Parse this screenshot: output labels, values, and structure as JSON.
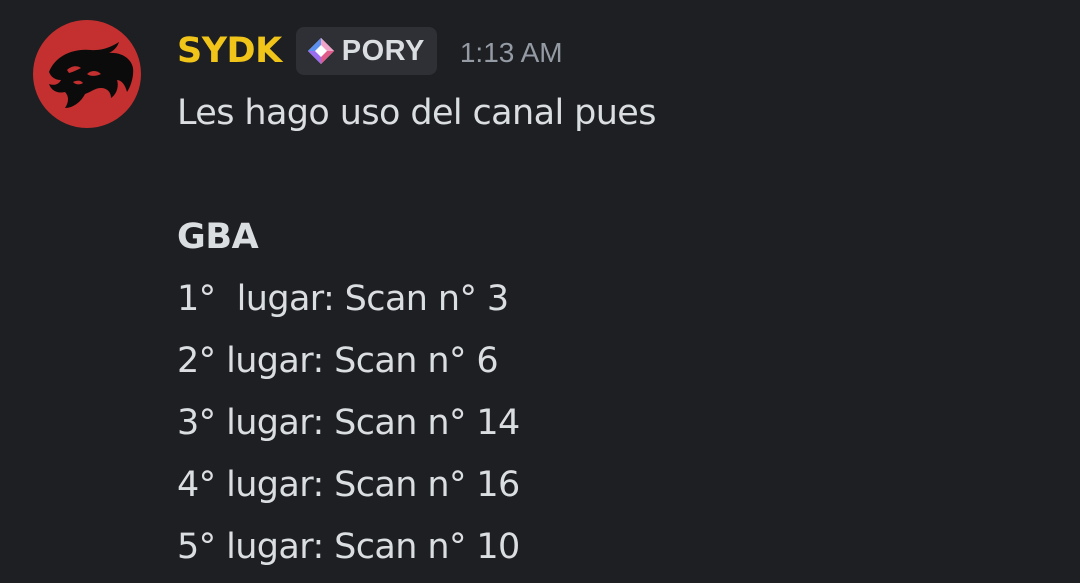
{
  "message": {
    "author": "SYDK",
    "author_color": "#f0c419",
    "tag": {
      "icon": "diamond-gem-icon",
      "label": "PORY"
    },
    "timestamp": "1:13 AM",
    "avatar": {
      "icon": "thundercats-emblem-icon",
      "background": "#c3302f"
    },
    "lines": {
      "intro": "Les hago uso del canal pues",
      "heading": "GBA",
      "items": [
        "1°  lugar: Scan n° 3",
        "2° lugar: Scan n° 6",
        "3° lugar: Scan n° 14",
        "4° lugar: Scan n° 16",
        "5° lugar: Scan n° 10"
      ]
    }
  }
}
